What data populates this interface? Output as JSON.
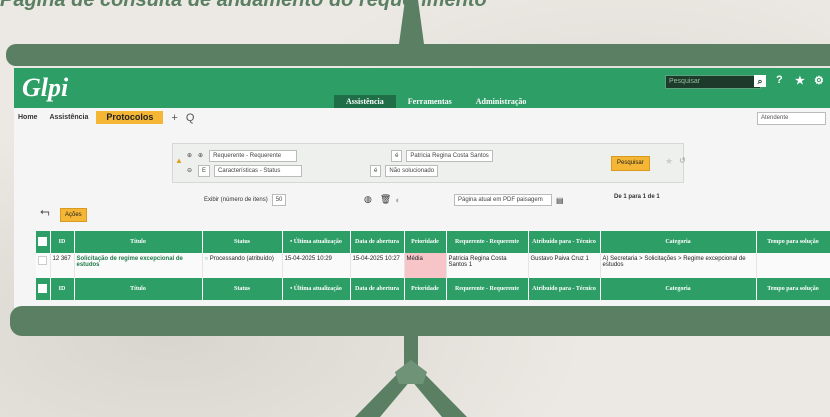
{
  "slide": {
    "title": "Página de consulta de andamento do requerimento"
  },
  "header": {
    "logo": "Glpi",
    "search_placeholder": "Pesquisar",
    "search_icon": "search-icon",
    "icons": [
      "help-icon",
      "star-icon",
      "gear-icon"
    ],
    "icon_glyphs": [
      "?",
      "★",
      "⚙"
    ],
    "menu": [
      {
        "label": "Assistência",
        "active": true
      },
      {
        "label": "Ferramentas",
        "active": false
      },
      {
        "label": "Administração",
        "active": false
      }
    ]
  },
  "breadcrumb": {
    "items": [
      "Home",
      "Assistência",
      "Protocolos"
    ],
    "add_icon": "+",
    "search_icon": "Q",
    "profile": "Atendente"
  },
  "criteria": {
    "row1": {
      "field": "Requerente - Requerente",
      "op": "é",
      "value": "Patricia Regina Costa Santos"
    },
    "row2": {
      "logic": "E",
      "field": "Características - Status",
      "op": "é",
      "value": "Não solucionado"
    },
    "search_button": "Pesquisar"
  },
  "controls": {
    "items_label": "Exibir (número de itens)",
    "items_value": "50",
    "export_select": "Página atual em PDF paisagem",
    "pagination": "De 1 para 1 de 1",
    "actions_button": "Ações"
  },
  "table": {
    "headers": [
      "ID",
      "Título",
      "Status",
      "• Última atualização",
      "Data de abertura",
      "Prioridade",
      "Requerente - Requerente",
      "Atribuído para - Técnico",
      "Categoria",
      "Tempo para solução"
    ],
    "rows": [
      {
        "id": "12 367",
        "title": "Solicitação de regime excepcional de estudos",
        "status": "Processando (atribuído)",
        "updated": "15-04-2025 10:29",
        "opened": "15-04-2025 10:27",
        "priority": "Média",
        "requester": "Patricia Regina Costa Santos 1",
        "technician": "Gustavo Paiva Cruz 1",
        "category": "A) Secretaria > Solicitações > Regime excepcional de estudos",
        "time": ""
      }
    ]
  },
  "colors": {
    "brand": "#2e9e67",
    "accent": "#f4b634",
    "frame": "#5b7f63"
  }
}
